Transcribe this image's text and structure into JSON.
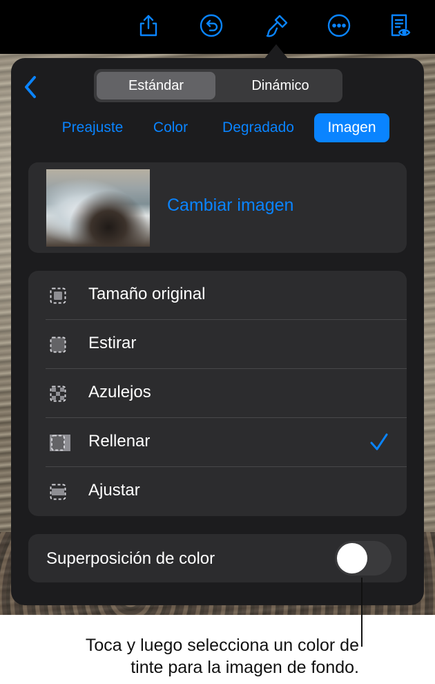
{
  "toolbar": {
    "icons": [
      "share-icon",
      "undo-icon",
      "format-brush-icon",
      "more-icon",
      "reading-view-icon"
    ]
  },
  "popover": {
    "segments": [
      "Estándar",
      "Dinámico"
    ],
    "selected_segment": "Estándar",
    "tabs": [
      "Preajuste",
      "Color",
      "Degradado",
      "Imagen"
    ],
    "selected_tab": "Imagen",
    "image_card": {
      "change_label": "Cambiar imagen"
    },
    "fill_options": [
      {
        "label": "Tamaño original",
        "icon": "original-size-icon"
      },
      {
        "label": "Estirar",
        "icon": "stretch-icon"
      },
      {
        "label": "Azulejos",
        "icon": "tile-icon"
      },
      {
        "label": "Rellenar",
        "icon": "fill-icon",
        "selected": true
      },
      {
        "label": "Ajustar",
        "icon": "fit-icon"
      }
    ],
    "overlay": {
      "label": "Superposición de color",
      "enabled": false
    }
  },
  "caption": {
    "line1": "Toca y luego selecciona un color de",
    "line2": "tinte para la imagen de fondo."
  },
  "colors": {
    "accent": "#0a84ff",
    "panel": "#1c1c1e",
    "card": "#2c2c2e"
  }
}
